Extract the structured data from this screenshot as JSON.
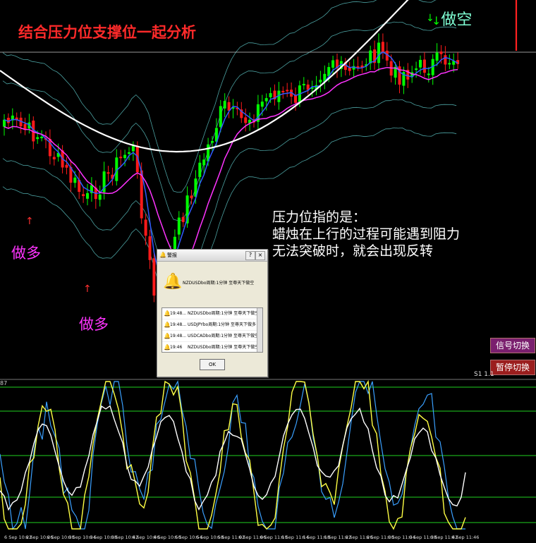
{
  "annotations": {
    "title": "结合压力位支撑位一起分析",
    "sell_top": "做空",
    "buy_1": "做多",
    "buy_2": "做多",
    "explanation": [
      "压力位指的是：",
      "蜡烛在上行的过程可能遇到阻力",
      "无法突破时，就会出现反转"
    ]
  },
  "side_buttons": {
    "signal": "信号切换",
    "pause": "暂停切换"
  },
  "price_label": "S1  1.1",
  "osc_top_value": "87",
  "time_axis": [
    "6 Sep 10:22",
    "6 Sep 10:26",
    "6 Sep 10:30",
    "6 Sep 10:34",
    "6 Sep 10:38",
    "6 Sep 10:42",
    "6 Sep 10:46",
    "6 Sep 10:50",
    "6 Sep 10:54",
    "6 Sep 10:58",
    "6 Sep 11:02",
    "6 Sep 11:06",
    "6 Sep 11:10",
    "6 Sep 11:14",
    "6 Sep 11:18",
    "6 Sep 11:22",
    "6 Sep 11:26",
    "6 Sep 11:30",
    "6 Sep 11:34",
    "6 Sep 11:38",
    "6 Sep 11:42",
    "6 Sep 11:46"
  ],
  "dialog": {
    "title": "警报",
    "help": "?",
    "close": "×",
    "main_message": "NZDUSDbo周期:1分钟 至尊天下做空",
    "rows": [
      {
        "time": "19:48...",
        "msg": "NZDUSDbo周期:1分钟 至尊天下做空"
      },
      {
        "time": "19:48...",
        "msg": "USDJPYbo周期:1分钟 至尊天下做多"
      },
      {
        "time": "19:48...",
        "msg": "USDCADbo周期:1分钟 至尊天下做空"
      },
      {
        "time": "19:46",
        "msg": "NZDUSDbo周期:1分钟 至尊天下做空"
      }
    ],
    "ok": "OK"
  },
  "colors": {
    "bull": "#00ff00",
    "bear": "#ff1a1a",
    "fast_ma": "#2f5bff",
    "mid_ma": "#ff33ff",
    "slow_ma": "#ffffff",
    "bands": "#5ec8c8",
    "osc_yellow": "#ffff44",
    "osc_blue": "#3aa0ff",
    "osc_white": "#ffffff",
    "level": "#1fcf1f"
  }
}
